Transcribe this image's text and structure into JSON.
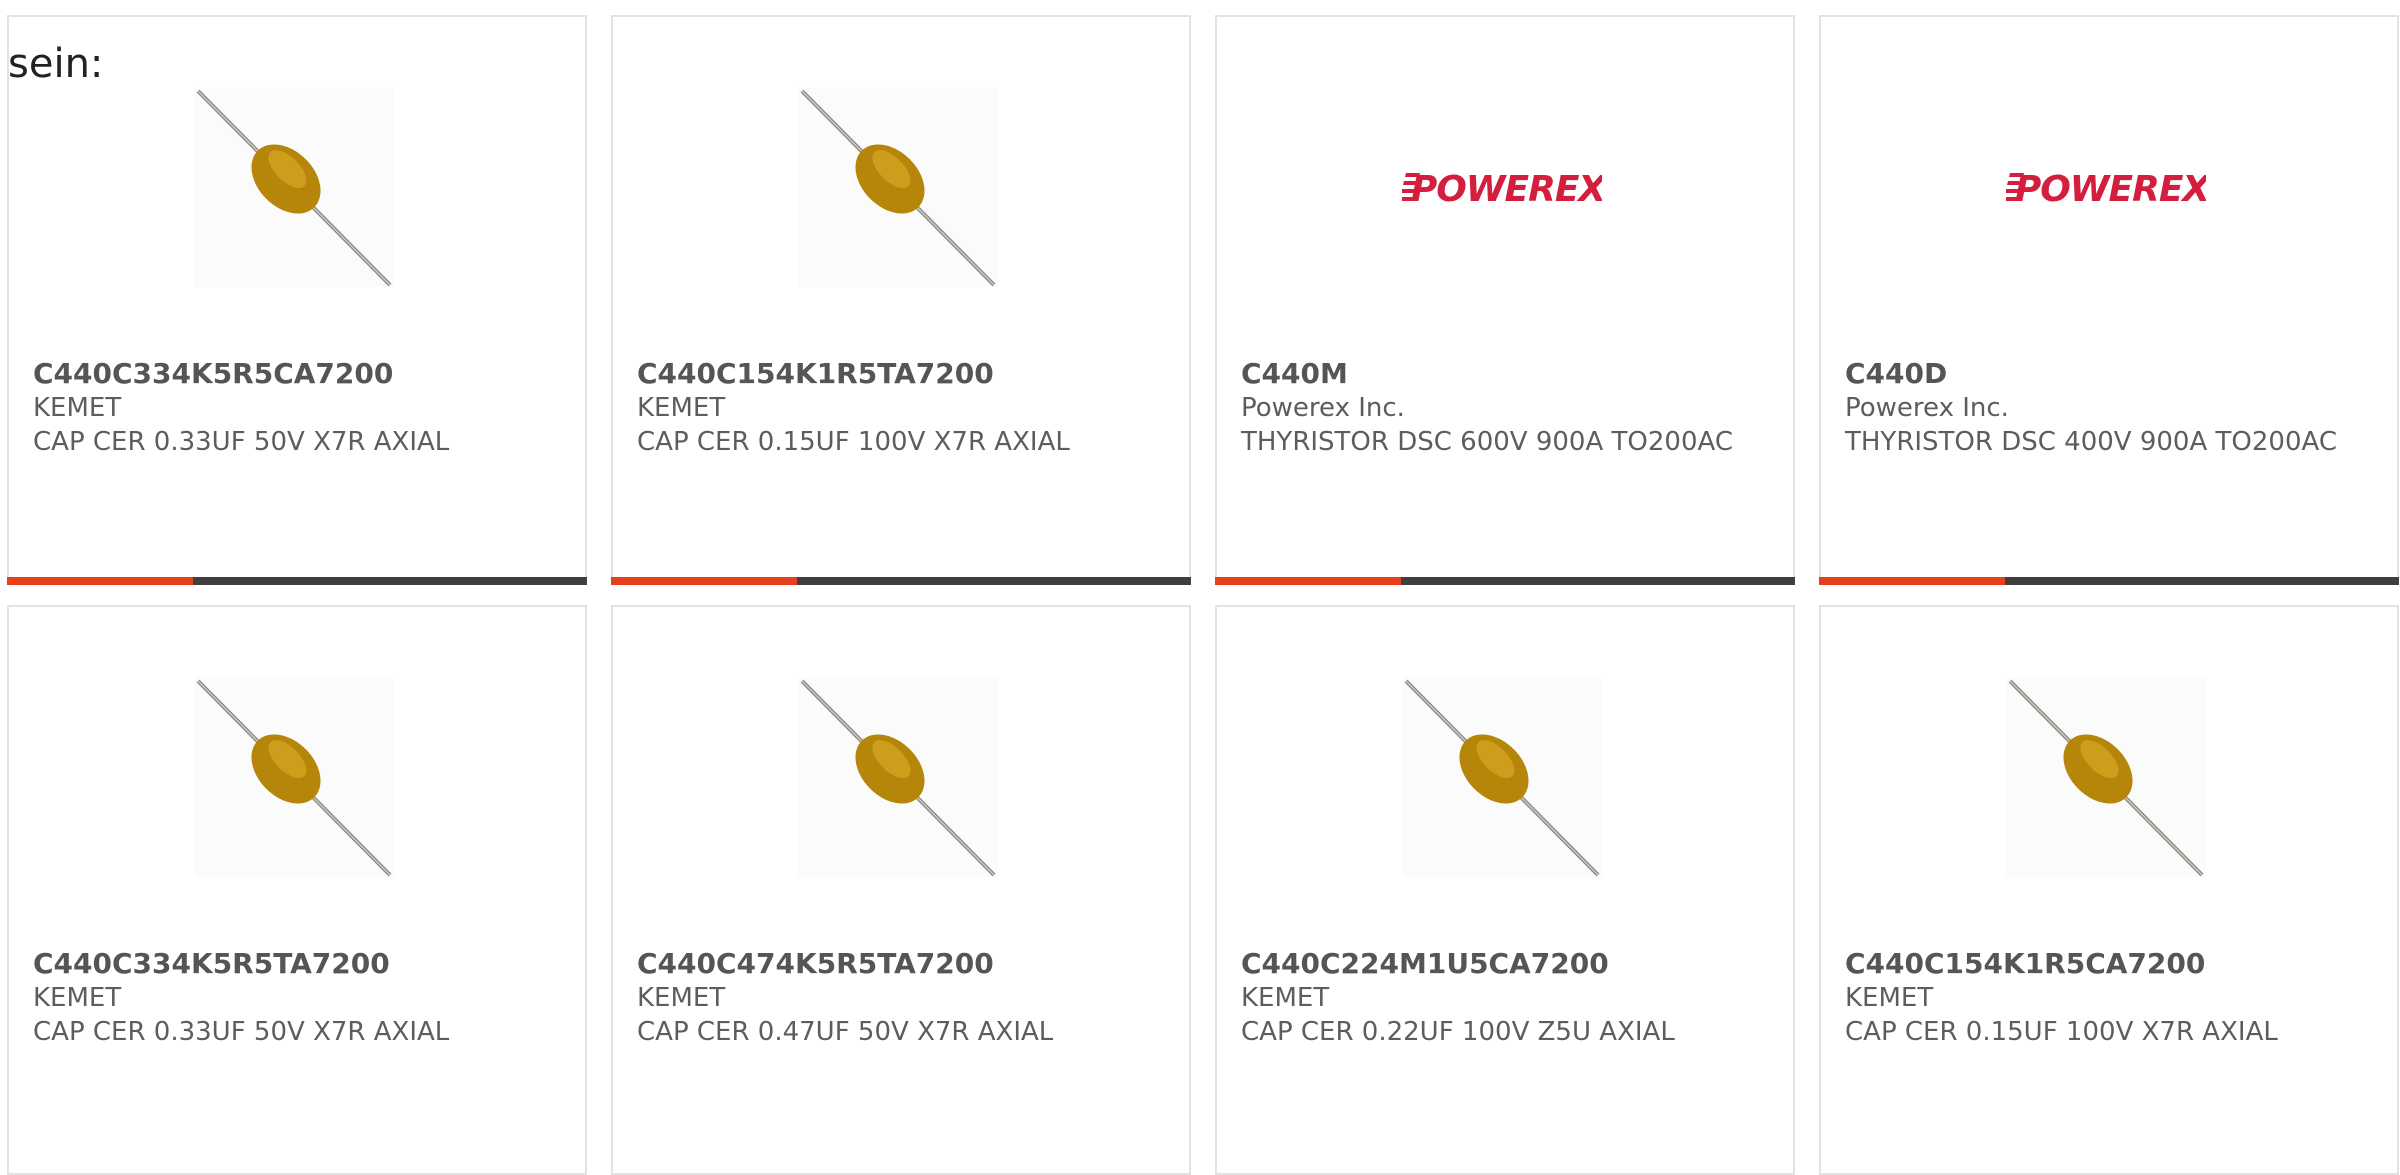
{
  "intro_text": "sein:",
  "colors": {
    "accent": "#e8401c",
    "bar_track": "#3f3f3f",
    "border": "#e2e2e2",
    "text": "#5d5d5d",
    "capacitor_body": "#c8930a",
    "powerex_logo": "#d31f3d"
  },
  "cards": [
    {
      "part": "C440C334K5R5CA7200",
      "manufacturer": "KEMET",
      "description": "CAP CER 0.33UF 50V X7R AXIAL",
      "image": "axial-capacitor-image"
    },
    {
      "part": "C440C154K1R5TA7200",
      "manufacturer": "KEMET",
      "description": "CAP CER 0.15UF 100V X7R AXIAL",
      "image": "axial-capacitor-image"
    },
    {
      "part": "C440M",
      "manufacturer": "Powerex Inc.",
      "description": "THYRISTOR DSC 600V 900A TO200AC",
      "image": "powerex-logo",
      "logo_text": "POWEREX"
    },
    {
      "part": "C440D",
      "manufacturer": "Powerex Inc.",
      "description": "THYRISTOR DSC 400V 900A TO200AC",
      "image": "powerex-logo",
      "logo_text": "POWEREX"
    },
    {
      "part": "C440C334K5R5TA7200",
      "manufacturer": "KEMET",
      "description": "CAP CER 0.33UF 50V X7R AXIAL",
      "image": "axial-capacitor-image"
    },
    {
      "part": "C440C474K5R5TA7200",
      "manufacturer": "KEMET",
      "description": "CAP CER 0.47UF 50V X7R AXIAL",
      "image": "axial-capacitor-image"
    },
    {
      "part": "C440C224M1U5CA7200",
      "manufacturer": "KEMET",
      "description": "CAP CER 0.22UF 100V Z5U AXIAL",
      "image": "axial-capacitor-image"
    },
    {
      "part": "C440C154K1R5CA7200",
      "manufacturer": "KEMET",
      "description": "CAP CER 0.15UF 100V X7R AXIAL",
      "image": "axial-capacitor-image"
    }
  ]
}
